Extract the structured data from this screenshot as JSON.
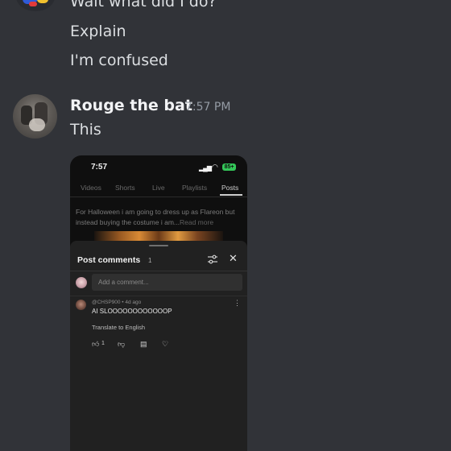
{
  "previous_messages": [
    "Wait what did I do?",
    "Explain",
    "I'm confused"
  ],
  "message": {
    "author": "Rouge the bat",
    "timestamp": "7:57 PM",
    "text": "This"
  },
  "embedded_screenshot": {
    "status_time": "7:57",
    "battery": "85+",
    "tabs": [
      "Videos",
      "Shorts",
      "Live",
      "Playlists",
      "Posts"
    ],
    "active_tab": "Posts",
    "post_text": "For Halloween i am going to dress up as Flareon but instead buying the costume i am...",
    "read_more": "Read more",
    "comments_panel": {
      "title": "Post comments",
      "count": "1",
      "add_comment_placeholder": "Add a comment...",
      "comment": {
        "meta": "@CHSP900 • 4d ago",
        "text": "AI SLOOOOOOOOOOOOP",
        "translate": "Translate to English",
        "likes": "1"
      }
    }
  }
}
